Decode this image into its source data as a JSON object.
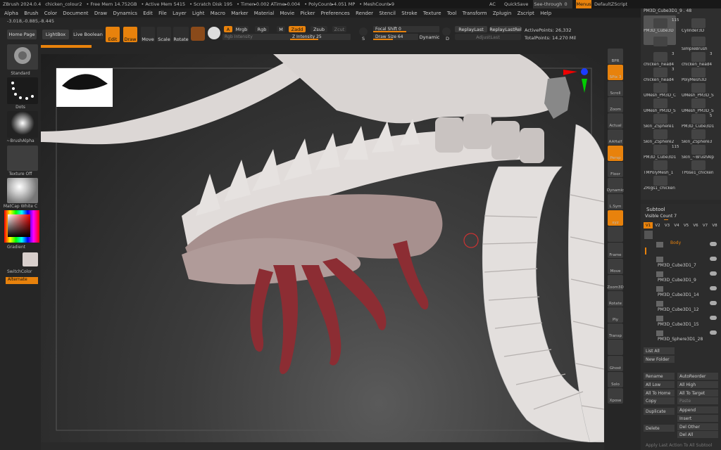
{
  "titlebar": {
    "app": "ZBrush 2024.0.4",
    "doc": "chicken_colour2",
    "freemem": "• Free Mem 14.752GB",
    "activemem": "• Active Mem 5415",
    "scratch": "• Scratch Disk 195",
    "timer": "• Timer▸0.002 ATime▸0.004",
    "polycount": "• PolyCount▸4.051 MP",
    "meshcount": "• MeshCount▸9",
    "ac": "AC",
    "quicksave": "QuickSave",
    "seethrough": "See-through",
    "seethrough_val": "0",
    "menus": "Menus",
    "script": "DefaultZScript"
  },
  "menu": [
    "Alpha",
    "Brush",
    "Color",
    "Document",
    "Draw",
    "Dynamics",
    "Edit",
    "File",
    "Layer",
    "Light",
    "Macro",
    "Marker",
    "Material",
    "Movie",
    "Picker",
    "Preferences",
    "Render",
    "Stencil",
    "Stroke",
    "Texture",
    "Tool",
    "Transform",
    "Zplugin",
    "Zscript",
    "Help"
  ],
  "coords": "-3.018,-0.885,-8.445",
  "toolbar": {
    "homepage": "Home Page",
    "lightbox": "LightBox",
    "liveboolean": "Live Boolean",
    "edit": "Edit",
    "draw": "Draw",
    "move": "Move",
    "scale": "Scale",
    "rotate": "Rotate",
    "a": "A",
    "mrgb": "Mrgb",
    "rgb": "Rgb",
    "m": "M",
    "zadd": "Zadd",
    "zsub": "Zsub",
    "zcut": "Zcut",
    "rgb_intensity": "Rgb Intensity",
    "z_intensity": "Z Intensity",
    "z_intensity_val": "25",
    "focal_shift": "Focal Shift",
    "focal_val": "0",
    "draw_size": "Draw Size",
    "draw_size_val": "64",
    "dynamic": "Dynamic",
    "s": "S",
    "d": "D",
    "replaylast": "ReplayLast",
    "replaylastrel": "ReplayLastRel",
    "adjustlast": "AdjustLast",
    "activepoints": "ActivePoints: 26,332",
    "totalpoints": "TotalPoints: 14.270 Mil"
  },
  "leftshelf": {
    "standard": "Standard",
    "dots": "Dots",
    "brushalpha": "~BrushAlpha",
    "textureoff": "Texture Off",
    "matcap": "MatCap White C",
    "gradient": "Gradient",
    "switchcolor": "SwitchColor",
    "alternate": "Alternate"
  },
  "rightshelf": [
    "BPR",
    "SPix 3",
    "Scroll",
    "Zoom",
    "Actual",
    "AAHalf",
    "Persp",
    "Floor",
    "Dynamic",
    "L.Sym",
    "xyz",
    "",
    "Frame",
    "Move",
    "Zoom3D",
    "Rotate",
    "Ply",
    "Transp",
    "",
    "Ghost",
    "Solo",
    "Xpose"
  ],
  "lightbox": {
    "header": "PM3D_Cube3D1_9 . 48",
    "tools": [
      {
        "name": "PM3D_Cube3D",
        "n": "115"
      },
      {
        "name": "Cylinder3D",
        "n": ""
      },
      {
        "name": "",
        "n": ""
      },
      {
        "name": "SimpleBrush",
        "n": ""
      },
      {
        "name": "chicken_head4",
        "n": "3"
      },
      {
        "name": "chicken_head4",
        "n": "3"
      },
      {
        "name": "chicken_head4",
        "n": "3"
      },
      {
        "name": "PolyMesh3D",
        "n": ""
      },
      {
        "name": "UMesh_PM3D_C",
        "n": ""
      },
      {
        "name": "UMesh_PM3D_S",
        "n": ""
      },
      {
        "name": "UMesh_PM3D_S",
        "n": ""
      },
      {
        "name": "UMesh_PM3D_S",
        "n": ""
      },
      {
        "name": "Skin_ZSphere1",
        "n": ""
      },
      {
        "name": "PM3D_Cube3D1",
        "n": "5"
      },
      {
        "name": "Skin_ZSphere2",
        "n": ""
      },
      {
        "name": "Skin_ZSphere3",
        "n": ""
      },
      {
        "name": "PM3D_Cube3D1",
        "n": "115"
      },
      {
        "name": "Skin_~BrushAlp",
        "n": ""
      },
      {
        "name": "TMPolyMesh_1",
        "n": ""
      },
      {
        "name": "TPose1_chicken",
        "n": ""
      },
      {
        "name": "ZRigs1_chicken",
        "n": ""
      }
    ]
  },
  "subtool": {
    "title": "Subtool",
    "visible": "Visible Count 7",
    "versions": [
      "V1",
      "V2",
      "V3",
      "V4",
      "V5",
      "V6",
      "V7",
      "V8"
    ],
    "items": [
      "Body",
      "PM3D_Cube3D1_7",
      "PM3D_Cube3D1_9",
      "PM3D_Cube3D1_14",
      "PM3D_Cube3D1_12",
      "PM3D_Cube3D1_15",
      "PM3D_Sphere3D1_28"
    ],
    "buttons": {
      "listall": "List All",
      "newfolder": "New Folder",
      "rename": "Rename",
      "autoreorder": "AutoReorder",
      "alllow": "All Low",
      "allhigh": "All High",
      "alltohome": "All To Home",
      "alltotarget": "All To Target",
      "copy": "Copy",
      "paste": "Paste",
      "append": "Append",
      "duplicate": "Duplicate",
      "insert": "Insert",
      "delete": "Delete",
      "delother": "Del Other",
      "delall": "Del All",
      "applylast": "Apply Last Action To All Subtool"
    }
  },
  "colors": {
    "accent": "#e8820c",
    "creature": "#ddd8d6",
    "flesh": "#a8918f",
    "tongue": "#8c2d33"
  }
}
